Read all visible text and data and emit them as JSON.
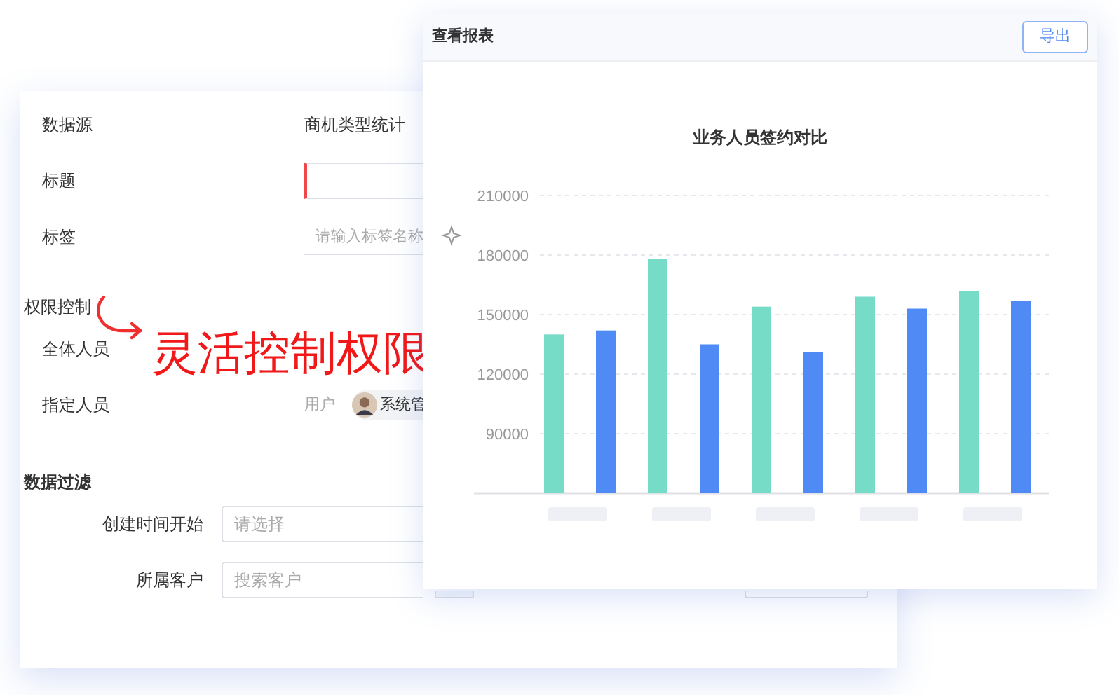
{
  "form": {
    "rows": [
      {
        "kind": "text",
        "label": "数据源",
        "value": "商机类型统计"
      },
      {
        "kind": "input",
        "label": "标题",
        "invalid": true
      },
      {
        "kind": "underline",
        "label": "标签",
        "placeholder": "请输入标签名称"
      }
    ],
    "permission": {
      "title": "权限控制",
      "rows": [
        {
          "kind": "blank",
          "label": "全体人员"
        },
        {
          "kind": "user",
          "label": "指定人员",
          "prefix": "用户",
          "user": "系统管"
        }
      ]
    },
    "filter": {
      "title": "数据过滤",
      "rows": [
        {
          "label": "创建时间开始",
          "placeholder": "请选择",
          "addon": false
        },
        {
          "label": "所属客户",
          "placeholder": "搜索客户",
          "addon": true
        }
      ]
    }
  },
  "annotation": {
    "text": "灵活控制权限"
  },
  "report": {
    "title": "查看报表",
    "export_button": "导出",
    "chart_data": {
      "type": "bar",
      "grid": true,
      "title": "业务人员签约对比",
      "ylim": [
        60000,
        210000
      ],
      "yticks": [
        90000,
        120000,
        150000,
        180000,
        210000
      ],
      "series": [
        {
          "color": "#76dcc8",
          "values": [
            140000,
            178000,
            154000,
            159000,
            162000
          ]
        },
        {
          "color": "#4f8af5",
          "values": [
            142000,
            135000,
            131000,
            153000,
            157000
          ]
        }
      ]
    }
  }
}
